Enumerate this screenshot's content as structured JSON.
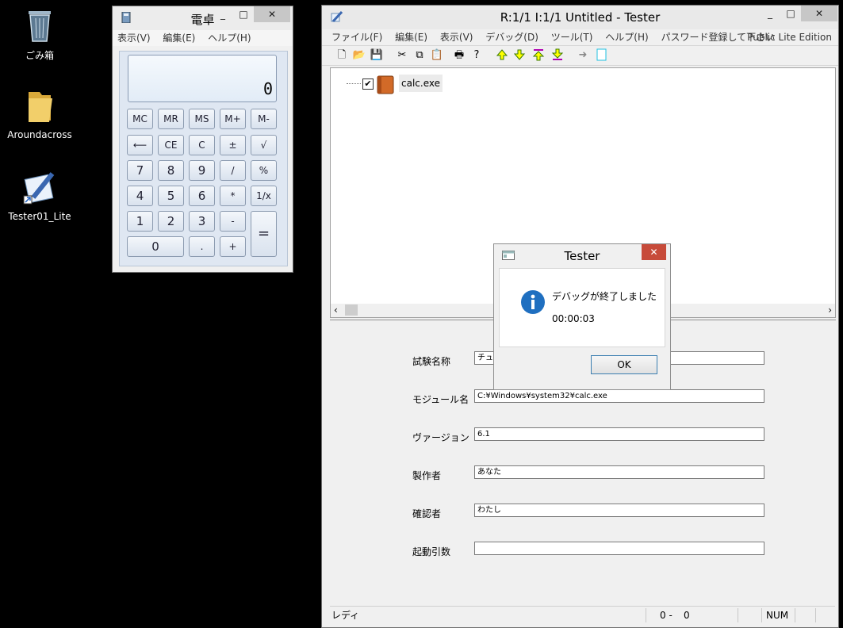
{
  "desktop": {
    "icons": [
      {
        "label": "ごみ箱"
      },
      {
        "label": "Aroundacross"
      },
      {
        "label": "Tester01_Lite"
      }
    ]
  },
  "calculator": {
    "title": "電卓",
    "menu": [
      "表示(V)",
      "編集(E)",
      "ヘルプ(H)"
    ],
    "display": "0",
    "buttons": {
      "mc": "MC",
      "mr": "MR",
      "ms": "MS",
      "mplus": "M+",
      "mminus": "M-",
      "back": "⟵",
      "ce": "CE",
      "c": "C",
      "pm": "±",
      "sqrt": "√",
      "n7": "7",
      "n8": "8",
      "n9": "9",
      "div": "/",
      "pct": "%",
      "n4": "4",
      "n5": "5",
      "n6": "6",
      "mul": "*",
      "inv": "1/x",
      "n1": "1",
      "n2": "2",
      "n3": "3",
      "sub": "-",
      "eq": "=",
      "n0": "0",
      "dot": ".",
      "add": "+"
    }
  },
  "tester": {
    "title": "R:1/1 I:1/1 Untitled - Tester",
    "menu": [
      "ファイル(F)",
      "編集(E)",
      "表示(V)",
      "デバッグ(D)",
      "ツール(T)",
      "ヘルプ(H)",
      "パスワード登録して下さい"
    ],
    "edition": "Public Lite Edition",
    "tree": {
      "item": "calc.exe"
    },
    "form": {
      "test_name": {
        "label": "試験名称",
        "value": "チュ"
      },
      "module": {
        "label": "モジュール名",
        "value": "C:¥Windows¥system32¥calc.exe"
      },
      "version": {
        "label": "ヴァージョン",
        "value": "6.1"
      },
      "author": {
        "label": "製作者",
        "value": "あなた"
      },
      "reviewer": {
        "label": "確認者",
        "value": "わたし"
      },
      "args": {
        "label": "起動引数",
        "value": ""
      }
    },
    "status": {
      "state": "レディ",
      "pos": "0 -",
      "pos2": "0",
      "num": "NUM"
    }
  },
  "dialog": {
    "title": "Tester",
    "message": "デバッグが終了しました",
    "time": "00:00:03",
    "ok": "OK"
  }
}
